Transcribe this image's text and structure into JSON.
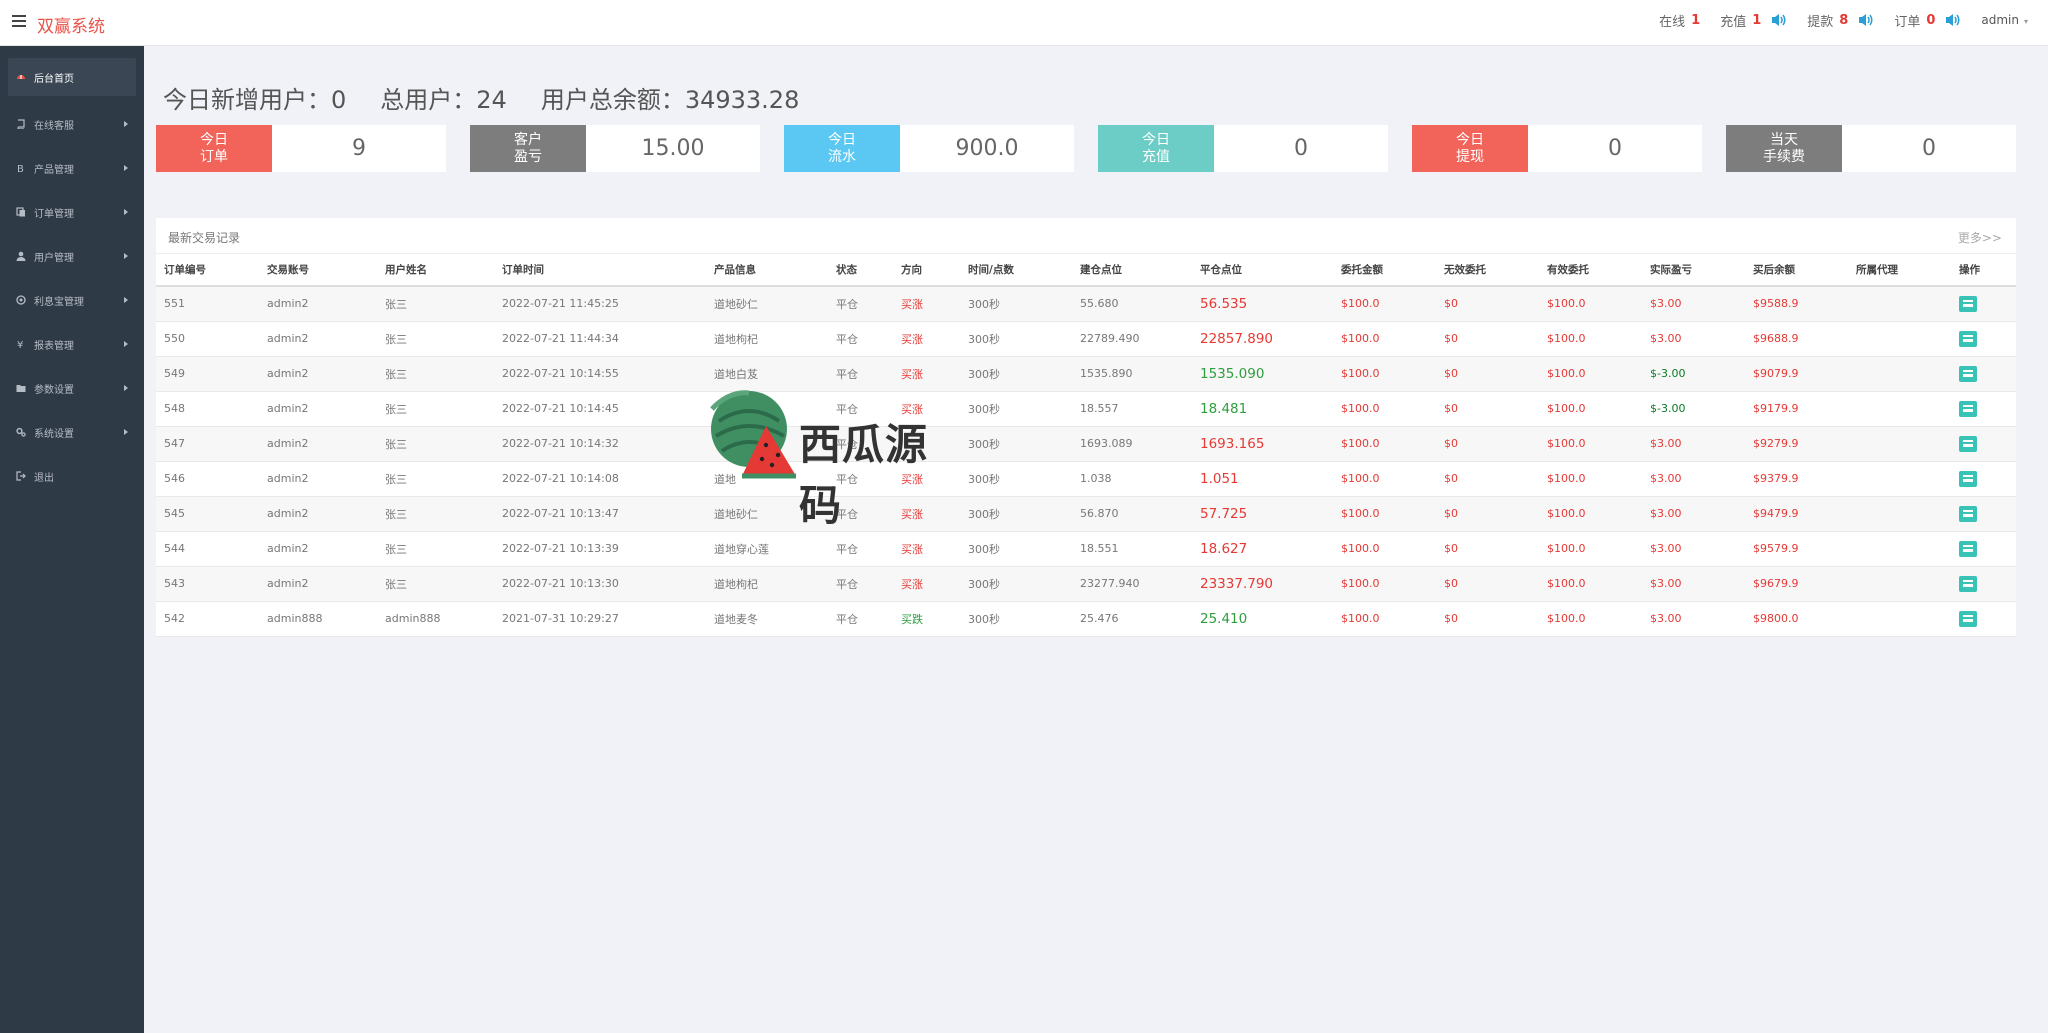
{
  "app": {
    "title": "双赢系统"
  },
  "topbar": {
    "stats": [
      {
        "label": "在线",
        "value": "1",
        "speaker": false
      },
      {
        "label": "充值",
        "value": "1",
        "speaker": true
      },
      {
        "label": "提款",
        "value": "8",
        "speaker": true
      },
      {
        "label": "订单",
        "value": "0",
        "speaker": true
      }
    ],
    "user": "admin"
  },
  "sidebar": {
    "items": [
      {
        "label": "后台首页",
        "icon": "dashboard-icon",
        "active": true,
        "arrow": false
      },
      {
        "label": "在线客服",
        "icon": "book-icon",
        "active": false,
        "arrow": true
      },
      {
        "label": "产品管理",
        "icon": "bitcoin-icon",
        "active": false,
        "arrow": true
      },
      {
        "label": "订单管理",
        "icon": "copy-icon",
        "active": false,
        "arrow": true
      },
      {
        "label": "用户管理",
        "icon": "user-icon",
        "active": false,
        "arrow": true
      },
      {
        "label": "利息宝管理",
        "icon": "coin-icon",
        "active": false,
        "arrow": true
      },
      {
        "label": "报表管理",
        "icon": "yen-icon",
        "active": false,
        "arrow": true
      },
      {
        "label": "参数设置",
        "icon": "folder-icon",
        "active": false,
        "arrow": true
      },
      {
        "label": "系统设置",
        "icon": "gears-icon",
        "active": false,
        "arrow": true
      },
      {
        "label": "退出",
        "icon": "sign-out-icon",
        "active": false,
        "arrow": false
      }
    ]
  },
  "headline": {
    "new_users_label": "今日新增用户：",
    "new_users": "0",
    "total_users_label": "总用户：",
    "total_users": "24",
    "balance_label": "用户总余额：",
    "balance": "34933.28"
  },
  "cards": [
    {
      "label": "今日\n订单",
      "value": "9",
      "color": "#f2645a"
    },
    {
      "label": "客户\n盈亏",
      "value": "15.00",
      "color": "#7d7d7d"
    },
    {
      "label": "今日\n流水",
      "value": "900.0",
      "color": "#5ac8f2"
    },
    {
      "label": "今日\n充值",
      "value": "0",
      "color": "#6ccdc6"
    },
    {
      "label": "今日\n提现",
      "value": "0",
      "color": "#f2645a"
    },
    {
      "label": "当天\n手续费",
      "value": "0",
      "color": "#7d7d7d"
    }
  ],
  "transactions": {
    "title": "最新交易记录",
    "more": "更多>>",
    "columns": [
      "订单编号",
      "交易账号",
      "用户姓名",
      "订单时间",
      "产品信息",
      "状态",
      "方向",
      "时间/点数",
      "建仓点位",
      "平仓点位",
      "委托金额",
      "无效委托",
      "有效委托",
      "实际盈亏",
      "买后余额",
      "所属代理",
      "操作"
    ],
    "rows": [
      {
        "id": "551",
        "account": "admin2",
        "name": "张三",
        "time": "2022-07-21 11:45:25",
        "product": "道地砂仁",
        "status": "平仓",
        "direction": "买涨",
        "dir_color": "red",
        "duration": "300秒",
        "open": "55.680",
        "close": "56.535",
        "close_color": "red",
        "amount": "$100.0",
        "invalid": "$0",
        "valid": "$100.0",
        "pnl": "$3.00",
        "pnl_color": "red",
        "balance": "$9588.9",
        "agent": ""
      },
      {
        "id": "550",
        "account": "admin2",
        "name": "张三",
        "time": "2022-07-21 11:44:34",
        "product": "道地枸杞",
        "status": "平仓",
        "direction": "买涨",
        "dir_color": "red",
        "duration": "300秒",
        "open": "22789.490",
        "close": "22857.890",
        "close_color": "red",
        "amount": "$100.0",
        "invalid": "$0",
        "valid": "$100.0",
        "pnl": "$3.00",
        "pnl_color": "red",
        "balance": "$9688.9",
        "agent": ""
      },
      {
        "id": "549",
        "account": "admin2",
        "name": "张三",
        "time": "2022-07-21 10:14:55",
        "product": "道地白芨",
        "status": "平仓",
        "direction": "买涨",
        "dir_color": "red",
        "duration": "300秒",
        "open": "1535.890",
        "close": "1535.090",
        "close_color": "green",
        "amount": "$100.0",
        "invalid": "$0",
        "valid": "$100.0",
        "pnl": "$-3.00",
        "pnl_color": "dkgreen",
        "balance": "$9079.9",
        "agent": ""
      },
      {
        "id": "548",
        "account": "admin2",
        "name": "张三",
        "time": "2022-07-21 10:14:45",
        "product": "",
        "status": "平仓",
        "direction": "买涨",
        "dir_color": "red",
        "duration": "300秒",
        "open": "18.557",
        "close": "18.481",
        "close_color": "green",
        "amount": "$100.0",
        "invalid": "$0",
        "valid": "$100.0",
        "pnl": "$-3.00",
        "pnl_color": "dkgreen",
        "balance": "$9179.9",
        "agent": ""
      },
      {
        "id": "547",
        "account": "admin2",
        "name": "张三",
        "time": "2022-07-21 10:14:32",
        "product": "",
        "status": "平仓",
        "direction": "",
        "dir_color": "red",
        "duration": "300秒",
        "open": "1693.089",
        "close": "1693.165",
        "close_color": "red",
        "amount": "$100.0",
        "invalid": "$0",
        "valid": "$100.0",
        "pnl": "$3.00",
        "pnl_color": "red",
        "balance": "$9279.9",
        "agent": ""
      },
      {
        "id": "546",
        "account": "admin2",
        "name": "张三",
        "time": "2022-07-21 10:14:08",
        "product": "道地",
        "status": "平仓",
        "direction": "买涨",
        "dir_color": "red",
        "duration": "300秒",
        "open": "1.038",
        "close": "1.051",
        "close_color": "red",
        "amount": "$100.0",
        "invalid": "$0",
        "valid": "$100.0",
        "pnl": "$3.00",
        "pnl_color": "red",
        "balance": "$9379.9",
        "agent": ""
      },
      {
        "id": "545",
        "account": "admin2",
        "name": "张三",
        "time": "2022-07-21 10:13:47",
        "product": "道地砂仁",
        "status": "平仓",
        "direction": "买涨",
        "dir_color": "red",
        "duration": "300秒",
        "open": "56.870",
        "close": "57.725",
        "close_color": "red",
        "amount": "$100.0",
        "invalid": "$0",
        "valid": "$100.0",
        "pnl": "$3.00",
        "pnl_color": "red",
        "balance": "$9479.9",
        "agent": ""
      },
      {
        "id": "544",
        "account": "admin2",
        "name": "张三",
        "time": "2022-07-21 10:13:39",
        "product": "道地穿心莲",
        "status": "平仓",
        "direction": "买涨",
        "dir_color": "red",
        "duration": "300秒",
        "open": "18.551",
        "close": "18.627",
        "close_color": "red",
        "amount": "$100.0",
        "invalid": "$0",
        "valid": "$100.0",
        "pnl": "$3.00",
        "pnl_color": "red",
        "balance": "$9579.9",
        "agent": ""
      },
      {
        "id": "543",
        "account": "admin2",
        "name": "张三",
        "time": "2022-07-21 10:13:30",
        "product": "道地枸杞",
        "status": "平仓",
        "direction": "买涨",
        "dir_color": "red",
        "duration": "300秒",
        "open": "23277.940",
        "close": "23337.790",
        "close_color": "red",
        "amount": "$100.0",
        "invalid": "$0",
        "valid": "$100.0",
        "pnl": "$3.00",
        "pnl_color": "red",
        "balance": "$9679.9",
        "agent": ""
      },
      {
        "id": "542",
        "account": "admin888",
        "name": "admin888",
        "time": "2021-07-31 10:29:27",
        "product": "道地麦冬",
        "status": "平仓",
        "direction": "买跌",
        "dir_color": "green",
        "duration": "300秒",
        "open": "25.476",
        "close": "25.410",
        "close_color": "green",
        "amount": "$100.0",
        "invalid": "$0",
        "valid": "$100.0",
        "pnl": "$3.00",
        "pnl_color": "red",
        "balance": "$9800.0",
        "agent": ""
      }
    ]
  },
  "watermark": {
    "text": "西瓜源码",
    "icon": "watermelon-icon"
  }
}
